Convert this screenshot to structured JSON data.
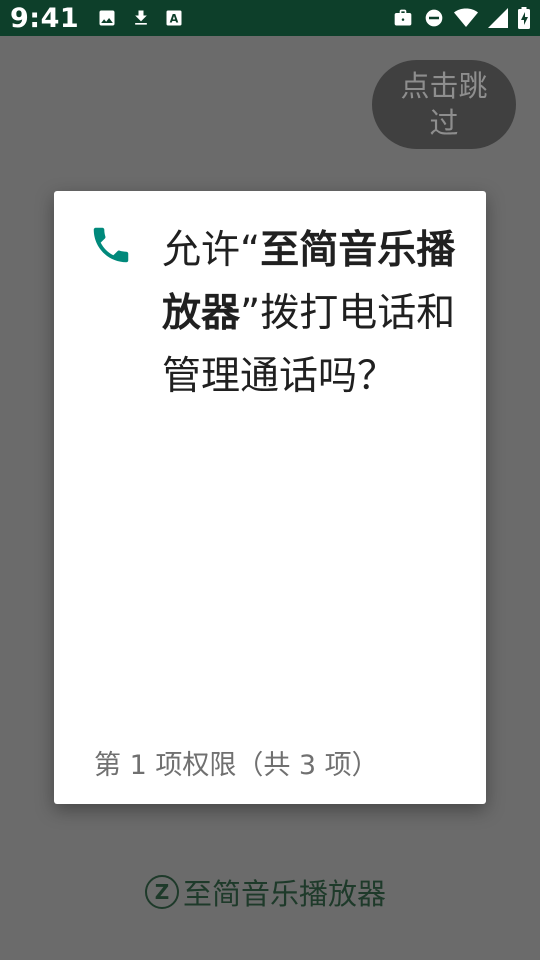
{
  "status_bar": {
    "time": "9:41",
    "left_icons": [
      "image-icon",
      "download-icon",
      "keyboard-a-icon"
    ],
    "right_icons": [
      "briefcase-icon",
      "dnd-icon",
      "wifi-icon",
      "signal-icon",
      "battery-charging-icon"
    ],
    "background": "#0d3f2a"
  },
  "background_app": {
    "skip_button": "点击跳过",
    "brand_logo": "Z",
    "brand_name": "至简音乐播放器"
  },
  "dialog": {
    "icon": "phone-icon",
    "icon_color": "#00897b",
    "message_prefix": "允许“",
    "app_name": "至简音乐播放器",
    "message_suffix": "”拨打电话和管理通话吗？",
    "counter": "第 1 项权限（共 3 项）"
  }
}
